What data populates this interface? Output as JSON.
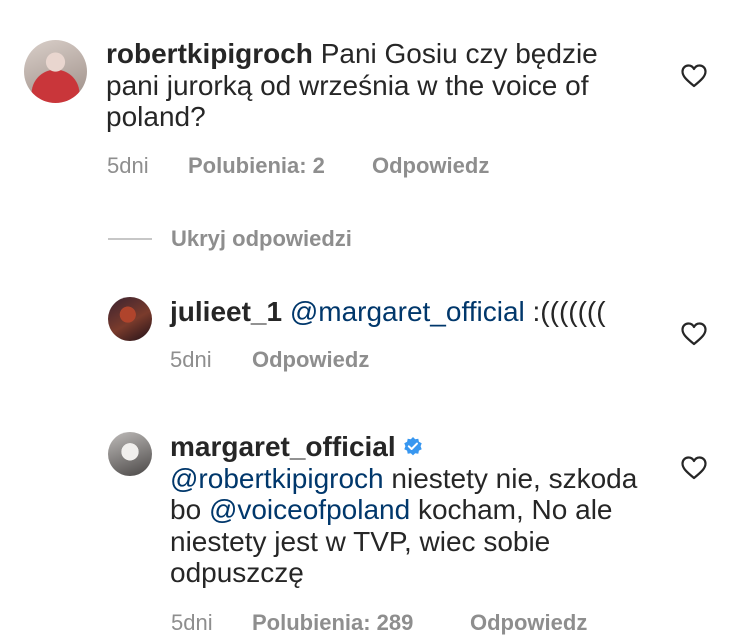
{
  "comments": [
    {
      "username": "robertkipigroch",
      "text": "Pani Gosiu czy będzie pani jurorką od września w the voice of poland?",
      "time": "5dni",
      "likes": "Polubienia: 2",
      "reply": "Odpowiedz"
    },
    {
      "username": "julieet_1",
      "mention": "@margaret_official",
      "text": " :(((((((",
      "time": "5dni",
      "reply": "Odpowiedz"
    },
    {
      "username": "margaret_official",
      "verified": true,
      "mention1": "@robertkipigroch",
      "text1": " niestety nie, szkoda bo ",
      "mention2": "@voiceofpoland",
      "text2": " kocham, No ale niestety jest w TVP, wiec sobie odpuszczę",
      "time": "5dni",
      "likes": "Polubienia: 289",
      "reply": "Odpowiedz"
    }
  ],
  "hide_replies": "Ukryj odpowiedzi",
  "icons": {
    "like": "heart-outline-icon",
    "verified": "verified-badge-icon"
  },
  "colors": {
    "text": "#262626",
    "meta": "#8e8e8e",
    "mention": "#00376b",
    "verified": "#3897f0"
  }
}
